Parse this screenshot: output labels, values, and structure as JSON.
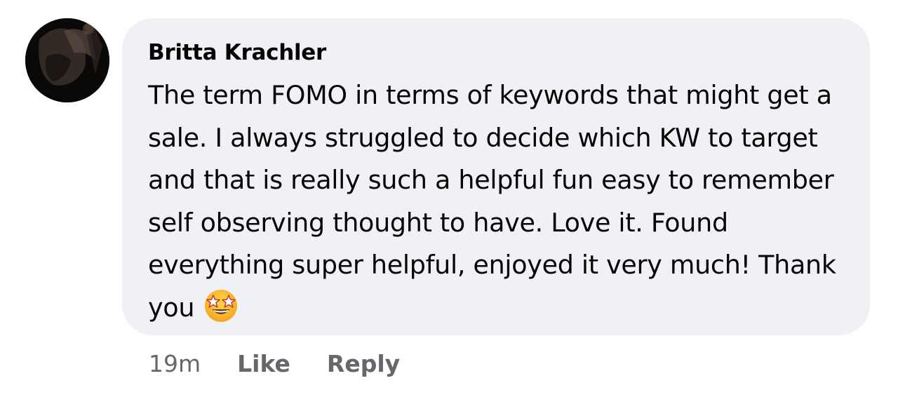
{
  "comment": {
    "author": "Britta Krachler",
    "text": "The term FOMO in terms of keywords that might get a sale. I always struggled to decide which KW to target and that is really such a helpful fun easy to remember self observing thought to have. Love it. Found everything super helpful, enjoyed it very much! Thank you",
    "emoji": "star-struck-emoji",
    "bubble_color": "#f0f1f5"
  },
  "actions": {
    "timestamp": "19m",
    "like_label": "Like",
    "reply_label": "Reply"
  },
  "avatar": {
    "icon": "profile-photo"
  }
}
